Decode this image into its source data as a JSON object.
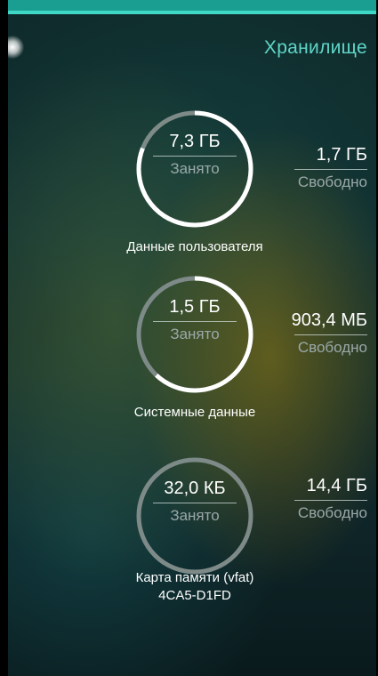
{
  "header": {
    "title": "Хранилище"
  },
  "storage": [
    {
      "used": "7,3 ГБ",
      "used_label": "Занято",
      "free": "1,7 ГБ",
      "free_label": "Свободно",
      "name": "Данные пользователя",
      "used_fraction": 0.81
    },
    {
      "used": "1,5 ГБ",
      "used_label": "Занято",
      "free": "903,4 МБ",
      "free_label": "Свободно",
      "name": "Системные данные",
      "used_fraction": 0.62
    },
    {
      "used": "32,0 КБ",
      "used_label": "Занято",
      "free": "14,4 ГБ",
      "free_label": "Свободно",
      "name": "Карта памяти (vfat)",
      "name2": "4CA5-D1FD",
      "used_fraction": 0.0
    }
  ],
  "colors": {
    "accent": "#5fd6c8",
    "ring_used": "#ffffff",
    "ring_free": "#7d8a88"
  }
}
